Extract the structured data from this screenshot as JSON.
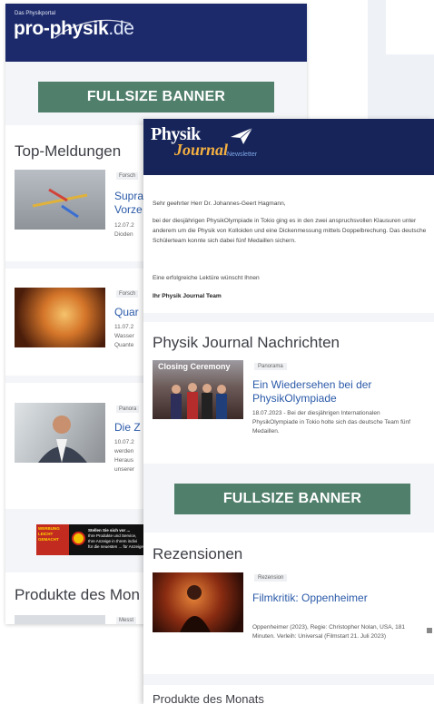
{
  "background": {
    "accent": "#eef1f6"
  },
  "back_newsletter": {
    "tagline": "Das Physikportal",
    "logo_main": "pro-physik",
    "logo_tld": ".de",
    "banner": "FULLSIZE BANNER",
    "section_top": "Top-Meldungen",
    "articles": [
      {
        "tag": "Forsch",
        "headline_lines": [
          "Supra",
          "Vorze"
        ],
        "meta_lines": [
          "12.07.2",
          "Dioden"
        ]
      },
      {
        "tag": "Forsch",
        "headline_lines": [
          "Quar"
        ],
        "meta_lines": [
          "11.07.2",
          "Wasser",
          "Quante"
        ]
      },
      {
        "tag": "Panora",
        "headline_lines": [
          "Die Z"
        ],
        "meta_lines": [
          "10.07.2",
          "werden",
          "Heraus",
          "unserer"
        ]
      }
    ],
    "ad": {
      "left_text": [
        "WERBUNG",
        "LEICHT",
        "GEMACHT"
      ],
      "right_text": [
        "Stellen Sie sich vor ...",
        "Ihre Produkte und Service,",
        "Ihre Anzeige in Ihrem indivi",
        "für die neuesten ... für Anzeige"
      ]
    },
    "section_products": "Produkte des Mon",
    "products_tag": "Messt"
  },
  "front_newsletter": {
    "logo_line1": "Physik",
    "logo_line2": "Journal",
    "logo_sub": "Newsletter",
    "greeting": "Sehr geehrter Herr Dr. Johannes-Geert Hagmann,",
    "body": "bei der diesjährigen PhysikOlympiade in Tokio ging es in den zwei anspruchsvollen Klausuren unter anderem um die Physik von Kolloiden und eine Dickenmessung mittels Doppelbrechung. Das deutsche Schülerteam konnte sich dabei fünf Medaillen sichern.",
    "closing": "Eine erfolgreiche Lektüre wünscht Ihnen",
    "signature": "Ihr Physik Journal Team",
    "news_title": "Physik Journal Nachrichten",
    "news_item": {
      "image_caption": "Closing Ceremony",
      "tag": "Panorama",
      "headline": "Ein Wiedersehen bei der PhysikOlympiade",
      "meta": "18.07.2023 - Bei der diesjährigen Internationalen PhysikOlympiade in Tokio holte sich das deutsche Team fünf Medaillen."
    },
    "banner": "FULLSIZE BANNER",
    "reviews_title": "Rezensionen",
    "review_item": {
      "tag": "Rezension",
      "headline": "Filmkritik: Oppenheimer",
      "meta": "Oppenheimer (2023), Regie: Christopher Nolan, USA, 181 Minuten. Verleih: Universal (Filmstart 21. Juli 2023)"
    },
    "bottom_title": "Produkte des Monats"
  },
  "colors": {
    "header_pp": "#1c2a6c",
    "header_pj": "#162459",
    "banner": "#507f6c",
    "link": "#2b5aa8",
    "logo_accent": "#f5b041"
  }
}
